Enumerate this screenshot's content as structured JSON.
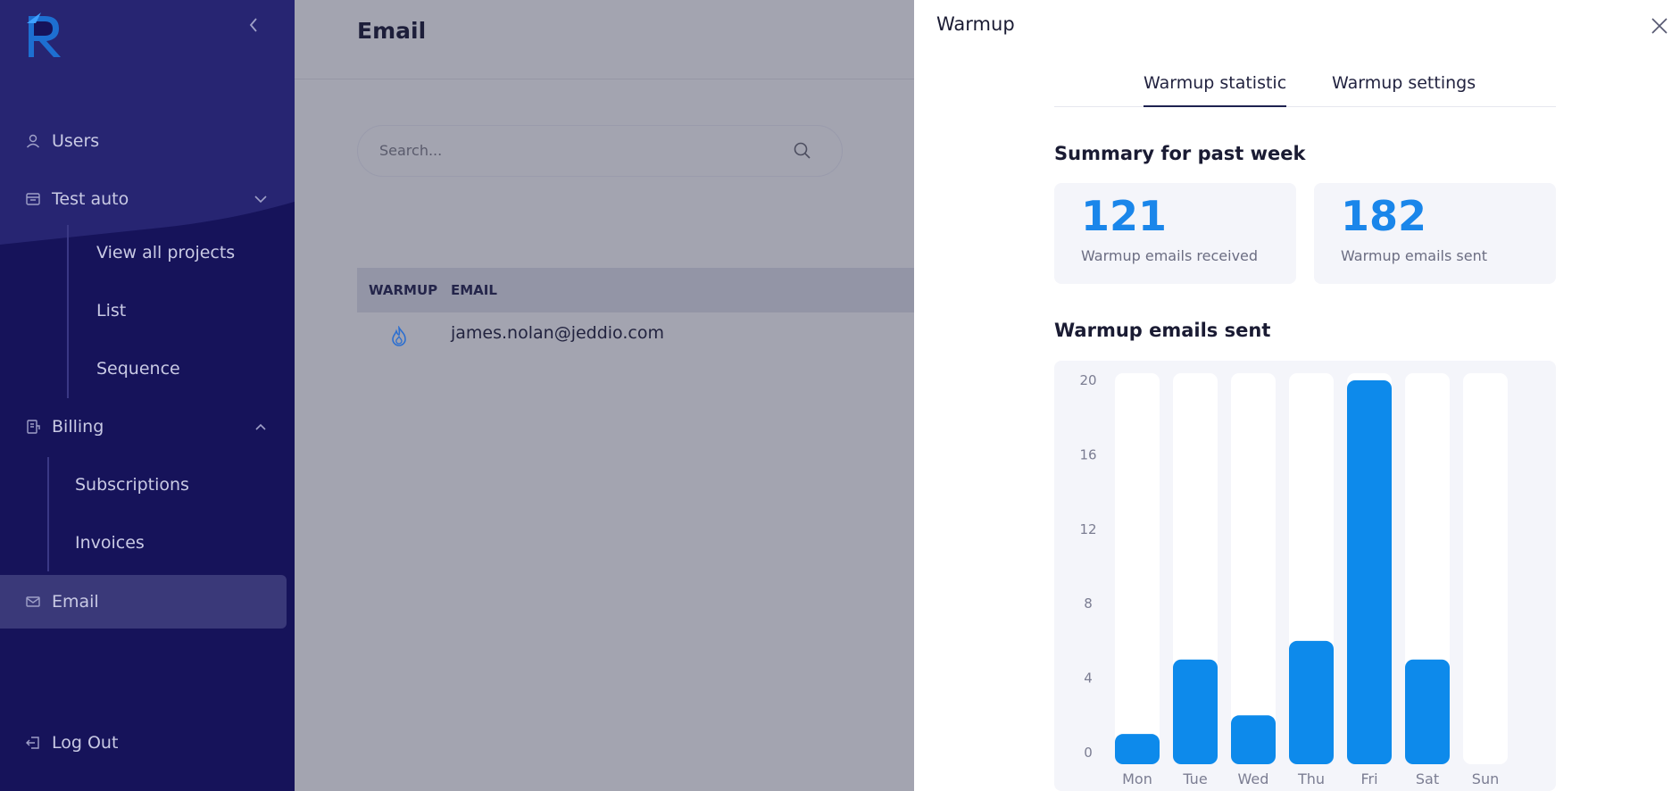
{
  "sidebar": {
    "items": [
      {
        "label": "Users",
        "icon": "user-icon"
      },
      {
        "label": "Test auto",
        "icon": "folder-icon",
        "expanded": true,
        "children": [
          "View all projects",
          "List",
          "Sequence"
        ]
      },
      {
        "label": "Billing",
        "icon": "billing-icon",
        "expanded": true,
        "children": [
          "Subscriptions",
          "Invoices"
        ]
      },
      {
        "label": "Email",
        "icon": "mail-icon",
        "active": true
      },
      {
        "label": "Log Out",
        "icon": "logout-icon"
      }
    ]
  },
  "main": {
    "title": "Email",
    "search_placeholder": "Search...",
    "table": {
      "columns": [
        "WARMUP",
        "EMAIL"
      ],
      "rows": [
        {
          "warmup_icon": "flame-icon",
          "email": "james.nolan@jeddio.com"
        }
      ]
    }
  },
  "drawer": {
    "title": "Warmup",
    "tabs": [
      {
        "label": "Warmup statistic",
        "active": true
      },
      {
        "label": "Warmup settings",
        "active": false
      }
    ],
    "summary_title": "Summary for past week",
    "cards": [
      {
        "value": "121",
        "caption": "Warmup emails received"
      },
      {
        "value": "182",
        "caption": "Warmup emails sent"
      }
    ],
    "chart_title": "Warmup emails sent"
  },
  "colors": {
    "sidebar": "#16135a",
    "accent": "#1a86ea",
    "overlay": "#a3a4b0"
  },
  "chart_data": {
    "type": "bar",
    "title": "Warmup emails sent",
    "categories": [
      "Mon",
      "Tue",
      "Wed",
      "Thu",
      "Fri",
      "Sat",
      "Sun"
    ],
    "values": [
      1,
      5,
      2,
      6,
      20,
      5,
      0
    ],
    "ylim": [
      0,
      20
    ],
    "yticks": [
      0,
      4,
      8,
      12,
      16,
      20
    ],
    "grid": false,
    "bar_color": "#0d8aeb",
    "track_color": "#ffffff"
  }
}
